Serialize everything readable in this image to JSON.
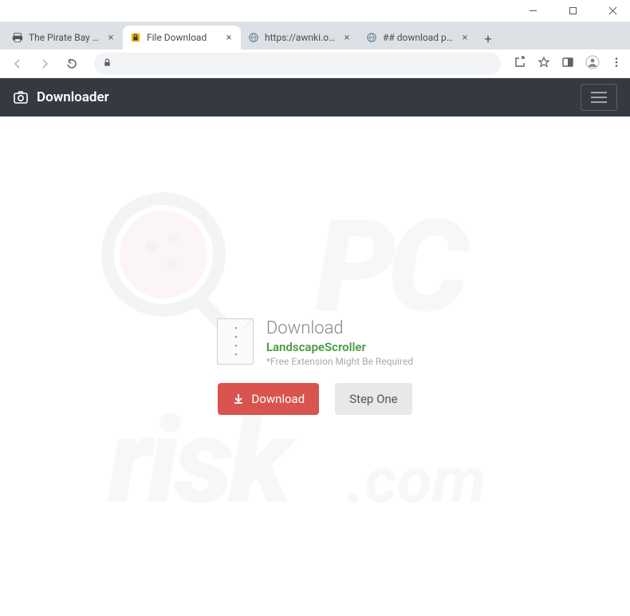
{
  "tabs": [
    {
      "title": "The Pirate Bay - The ga..."
    },
    {
      "title": "File Download"
    },
    {
      "title": "https://awnki.ofchildr.b..."
    },
    {
      "title": "## download page ##"
    }
  ],
  "navbar": {
    "brand": "Downloader"
  },
  "card": {
    "title": "Download",
    "name": "LandscapeScroller",
    "note": "*Free Extension Might Be Required",
    "download_btn": "Download",
    "step_btn": "Step One"
  }
}
